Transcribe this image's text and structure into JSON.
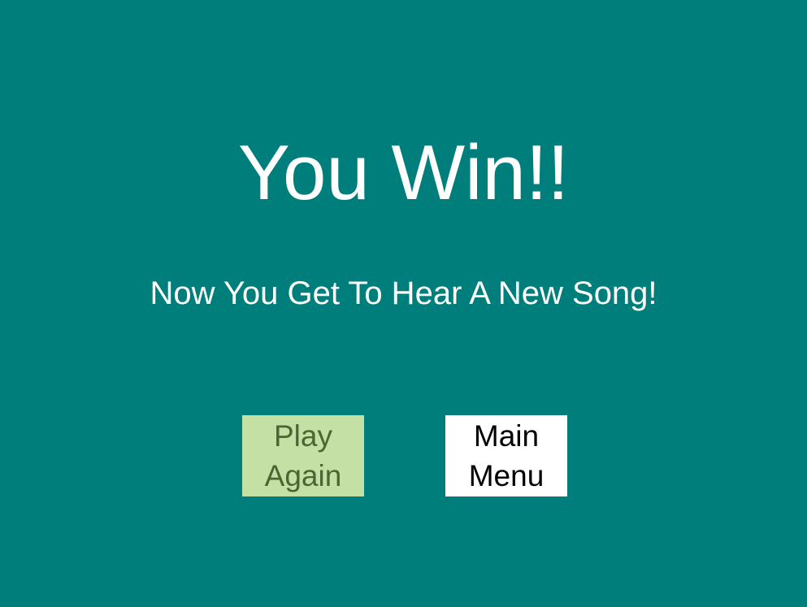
{
  "screen": {
    "title": "You Win!!",
    "subtitle": "Now You Get To Hear A New Song!",
    "background_color": "#007e7b"
  },
  "buttons": {
    "play_again": {
      "label": "Play Again",
      "background_color": "#c5e0a5",
      "text_color": "#4a6632"
    },
    "main_menu": {
      "label": "Main Menu",
      "background_color": "#ffffff",
      "text_color": "#000000"
    }
  }
}
